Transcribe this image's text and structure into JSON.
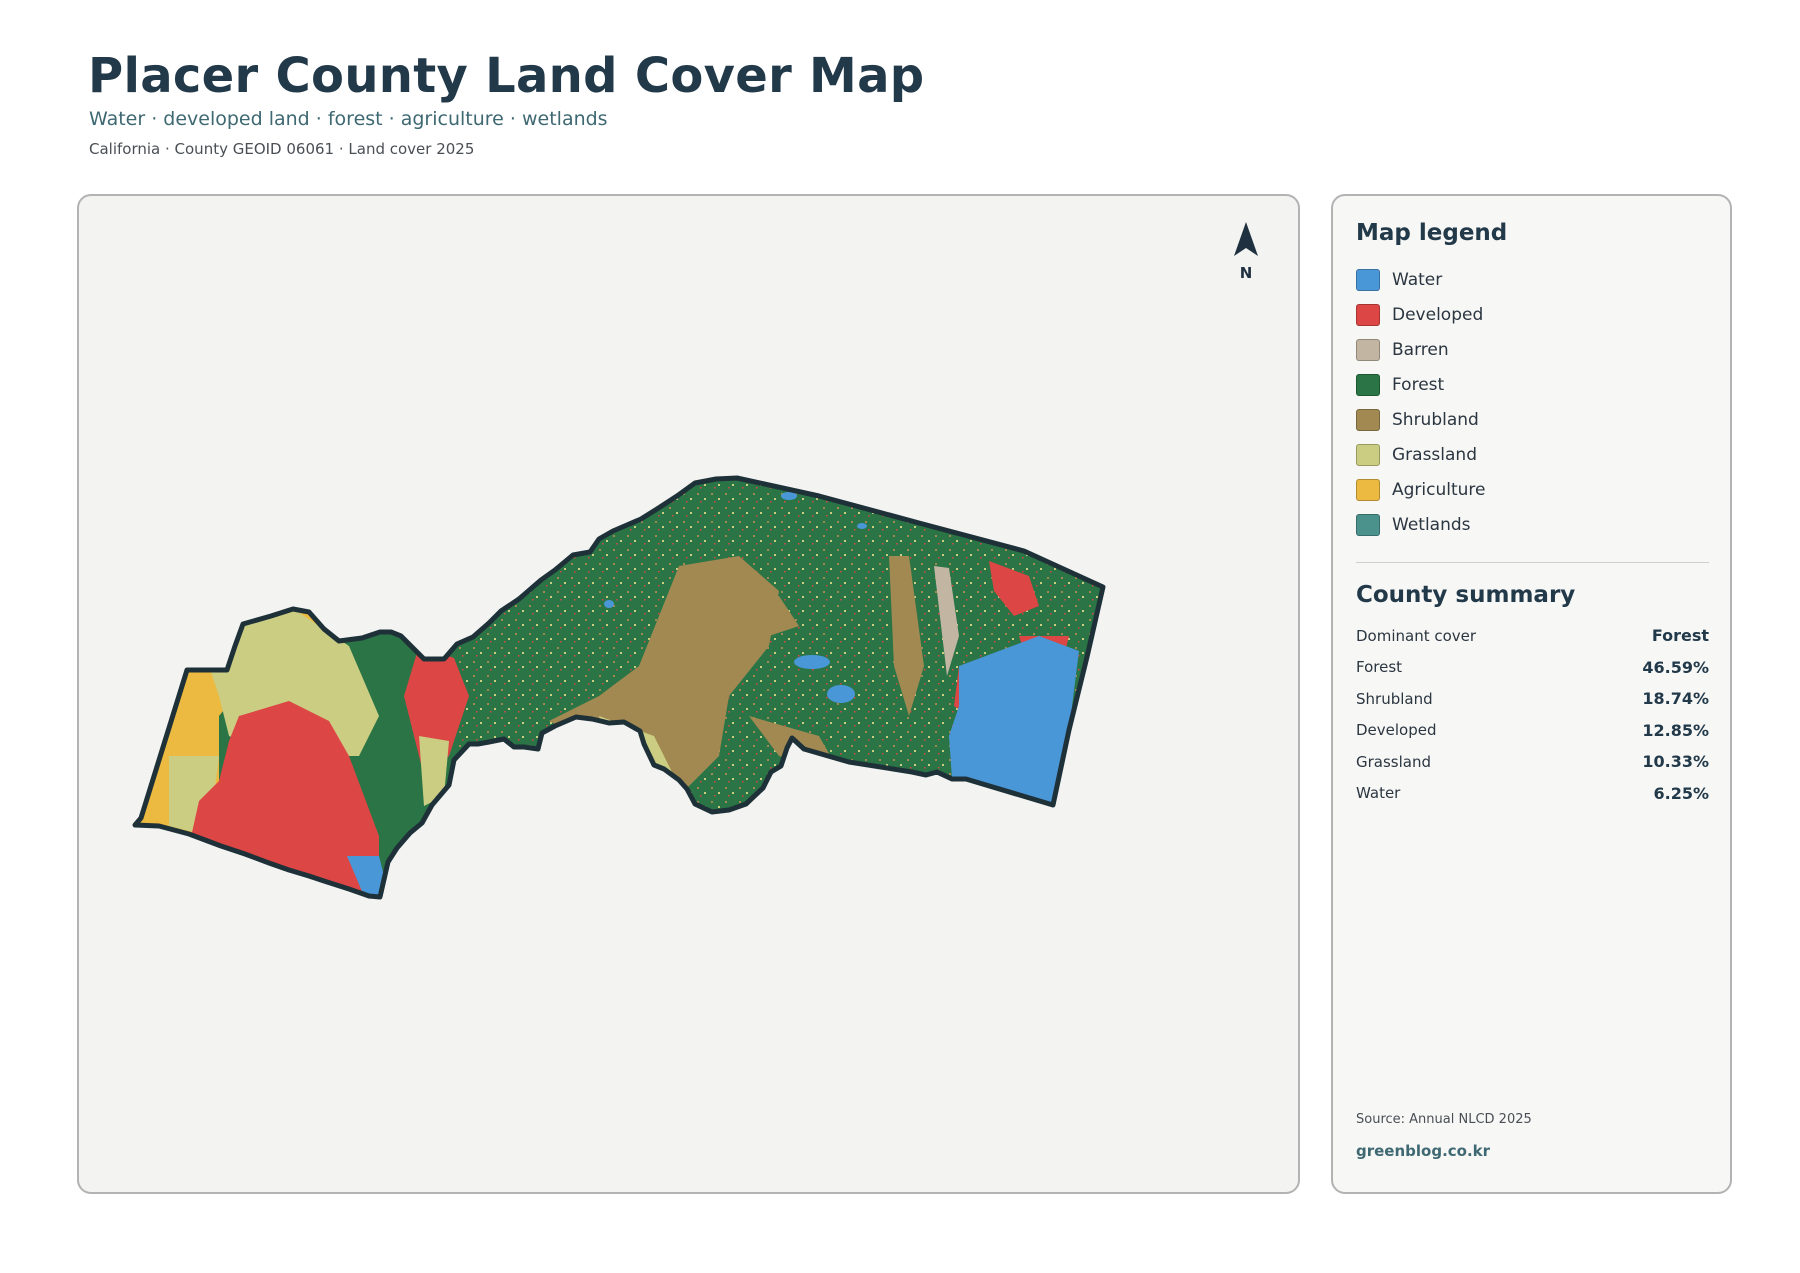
{
  "header": {
    "title": "Placer County Land Cover Map",
    "subtitle": "Water · developed land · forest · agriculture · wetlands",
    "meta": "California · County GEOID 06061 · Land cover 2025"
  },
  "map": {
    "north_label": "N",
    "boundary_color": "#1f3138"
  },
  "legend": {
    "title": "Map legend",
    "items": [
      {
        "label": "Water",
        "color": "#4a97d8"
      },
      {
        "label": "Developed",
        "color": "#dc4644"
      },
      {
        "label": "Barren",
        "color": "#c2b6a3"
      },
      {
        "label": "Forest",
        "color": "#2a7445"
      },
      {
        "label": "Shrubland",
        "color": "#a28851"
      },
      {
        "label": "Grassland",
        "color": "#cbcd82"
      },
      {
        "label": "Agriculture",
        "color": "#ecba41"
      },
      {
        "label": "Wetlands",
        "color": "#4b918c"
      }
    ]
  },
  "summary": {
    "title": "County summary",
    "rows": [
      {
        "label": "Dominant cover",
        "value": "Forest"
      },
      {
        "label": "Forest",
        "value": "46.59%"
      },
      {
        "label": "Shrubland",
        "value": "18.74%"
      },
      {
        "label": "Developed",
        "value": "12.85%"
      },
      {
        "label": "Grassland",
        "value": "10.33%"
      },
      {
        "label": "Water",
        "value": "6.25%"
      }
    ]
  },
  "footer": {
    "source": "Source: Annual NLCD 2025",
    "site": "greenblog.co.kr"
  }
}
